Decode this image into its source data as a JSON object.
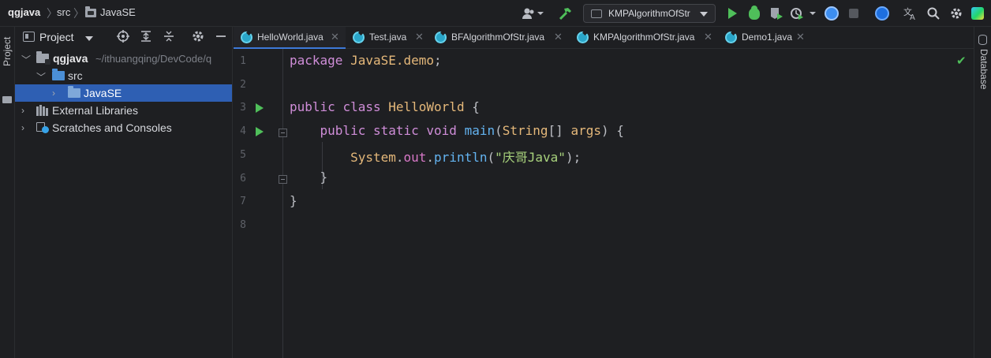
{
  "breadcrumb": {
    "project": "qgjava",
    "folder1": "src",
    "folder2": "JavaSE"
  },
  "toolbar": {
    "run_config": "KMPAlgorithmOfStr",
    "icons": [
      "user-dropdown-icon",
      "build-hammer-icon",
      "run-icon",
      "debug-icon",
      "coverage-icon",
      "profile-icon",
      "update-icon",
      "stop-icon",
      "help-icon",
      "translate-icon",
      "search-icon",
      "settings-icon",
      "jetbrains-icon"
    ]
  },
  "left_strip": {
    "label": "Project"
  },
  "right_strip": {
    "label": "Database"
  },
  "project_panel": {
    "title": "Project",
    "tree": {
      "root": {
        "label": "qgjava",
        "path": "~/ithuangqing/DevCode/q"
      },
      "src": {
        "label": "src"
      },
      "javase": {
        "label": "JavaSE"
      },
      "external": {
        "label": "External Libraries"
      },
      "scratches": {
        "label": "Scratches and Consoles"
      }
    }
  },
  "tabs": [
    {
      "label": "HelloWorld.java",
      "active": true
    },
    {
      "label": "Test.java"
    },
    {
      "label": "BFAlgorithmOfStr.java"
    },
    {
      "label": "KMPAlgorithmOfStr.java"
    },
    {
      "label": "Demo1.java"
    }
  ],
  "editor": {
    "line_numbers": [
      "1",
      "2",
      "3",
      "4",
      "5",
      "6",
      "7",
      "8"
    ],
    "line1": {
      "kw": "package",
      "pkg": "JavaSE.demo",
      "end": ";"
    },
    "line3": {
      "kw1": "public",
      "kw2": "class",
      "cls": "HelloWorld",
      "end": " {"
    },
    "line4": {
      "kw1": "public",
      "kw2": "static",
      "kw3": "void",
      "fn": "main",
      "p1": "(",
      "type": "String",
      "p2": "[] ",
      "param": "args",
      "end": ") {"
    },
    "line5": {
      "cls": "System",
      "dot1": ".",
      "field": "out",
      "dot2": ".",
      "fn": "println",
      "p1": "(",
      "str": "\"庆哥Java\"",
      "end": ");"
    },
    "line6": {
      "text": "}"
    },
    "line7": {
      "text": "}"
    }
  },
  "colors": {
    "keyword": "#cf8dd8",
    "class": "#e5b87a",
    "method": "#63b3f0",
    "field": "#d878c8",
    "string": "#a8d27c",
    "selection": "#2e5fb3",
    "run": "#4fbf5a"
  }
}
